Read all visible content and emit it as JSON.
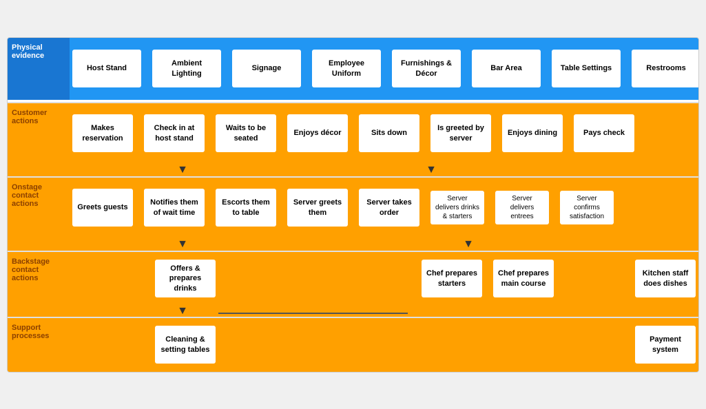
{
  "rows": {
    "physical_evidence": {
      "label": "Physical evidence",
      "items": [
        "Host Stand",
        "Ambient Lighting",
        "Signage",
        "Employee Uniform",
        "Furnishings & Décor",
        "Bar Area",
        "Table Settings",
        "Restrooms"
      ]
    },
    "customer_actions": {
      "label": "Customer actions",
      "items": [
        "Makes reservation",
        "Check in at host stand",
        "Waits to be seated",
        "Enjoys décor",
        "Sits down",
        "Is greeted by server",
        "Enjoys dining",
        "Pays check"
      ]
    },
    "onstage": {
      "label": "Onstage contact actions",
      "items": [
        "Greets guests",
        "Notifies them of wait time",
        "Escorts them to table",
        "Server greets them",
        "Server takes order",
        "Server delivers drinks & starters",
        "Server delivers entrees",
        "Server confirms satisfaction"
      ]
    },
    "backstage": {
      "label": "Backstage contact actions",
      "items": [
        "Offers & prepares drinks",
        "Chef prepares starters",
        "Chef prepares main course",
        "Kitchen staff does dishes"
      ]
    },
    "support": {
      "label": "Support processes",
      "items": [
        "Cleaning & setting tables",
        "Payment system"
      ]
    }
  }
}
